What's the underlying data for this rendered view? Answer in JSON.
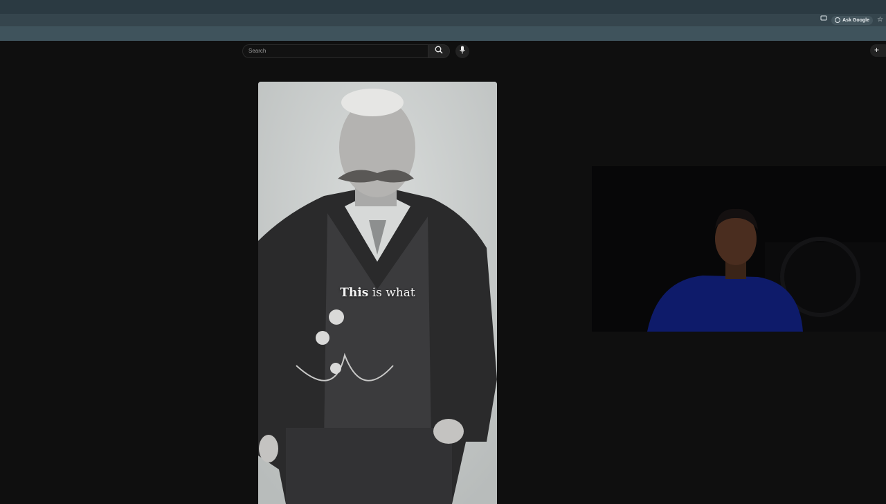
{
  "browser": {
    "ask_google_label": "Ask Google"
  },
  "header": {
    "search_placeholder": "Search",
    "create_label": "+"
  },
  "video": {
    "caption_bold": "This",
    "caption_rest": " is what"
  },
  "colors": {
    "page_bg": "#0f0f0f",
    "tabbar_bg": "#2b3a42",
    "toolbar_bg": "#35454d",
    "bookmarks_bg": "#3f535c"
  }
}
